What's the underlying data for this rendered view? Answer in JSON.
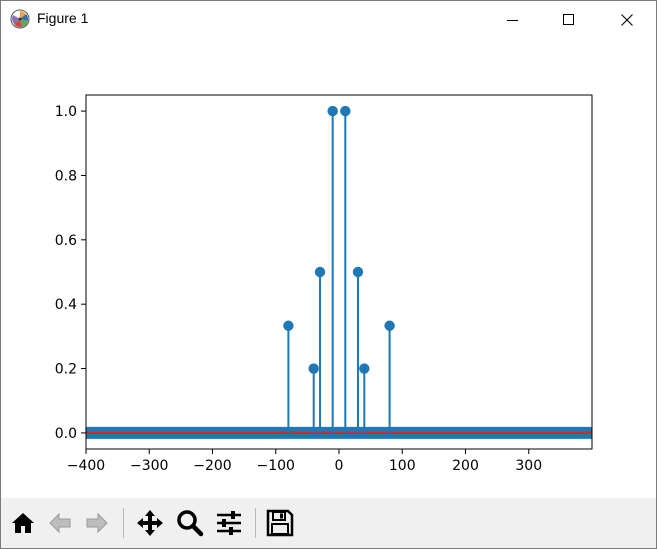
{
  "window": {
    "title": "Figure 1"
  },
  "toolbar": {
    "buttons": [
      {
        "name": "home",
        "icon": "home-icon"
      },
      {
        "name": "back",
        "icon": "arrow-left-icon"
      },
      {
        "name": "forward",
        "icon": "arrow-right-icon"
      },
      {
        "name": "pan",
        "icon": "move-icon"
      },
      {
        "name": "zoom",
        "icon": "magnifier-icon"
      },
      {
        "name": "configure",
        "icon": "sliders-icon"
      },
      {
        "name": "save",
        "icon": "floppy-icon"
      }
    ]
  },
  "chart_data": {
    "type": "stem",
    "title": "",
    "xlabel": "",
    "ylabel": "",
    "xlim": [
      -400,
      400
    ],
    "ylim": [
      -0.05,
      1.05
    ],
    "xticks": [
      -400,
      -300,
      -200,
      -100,
      0,
      100,
      200,
      300
    ],
    "xtick_labels": [
      "−400",
      "−300",
      "−200",
      "−100",
      "0",
      "100",
      "200",
      "300"
    ],
    "yticks": [
      0.0,
      0.2,
      0.4,
      0.6,
      0.8,
      1.0
    ],
    "ytick_labels": [
      "0.0",
      "0.2",
      "0.4",
      "0.6",
      "0.8",
      "1.0"
    ],
    "series": [
      {
        "x": [
          -80,
          -40,
          -30,
          -10,
          10,
          30,
          40,
          80
        ],
        "y": [
          0.333,
          0.2,
          0.5,
          1.0,
          1.0,
          0.5,
          0.2,
          0.333
        ],
        "color": "#1f77b4"
      }
    ],
    "baseline": {
      "y": 0,
      "color": "#1f77b4",
      "inner_color": "#d62728"
    },
    "grid": false
  }
}
